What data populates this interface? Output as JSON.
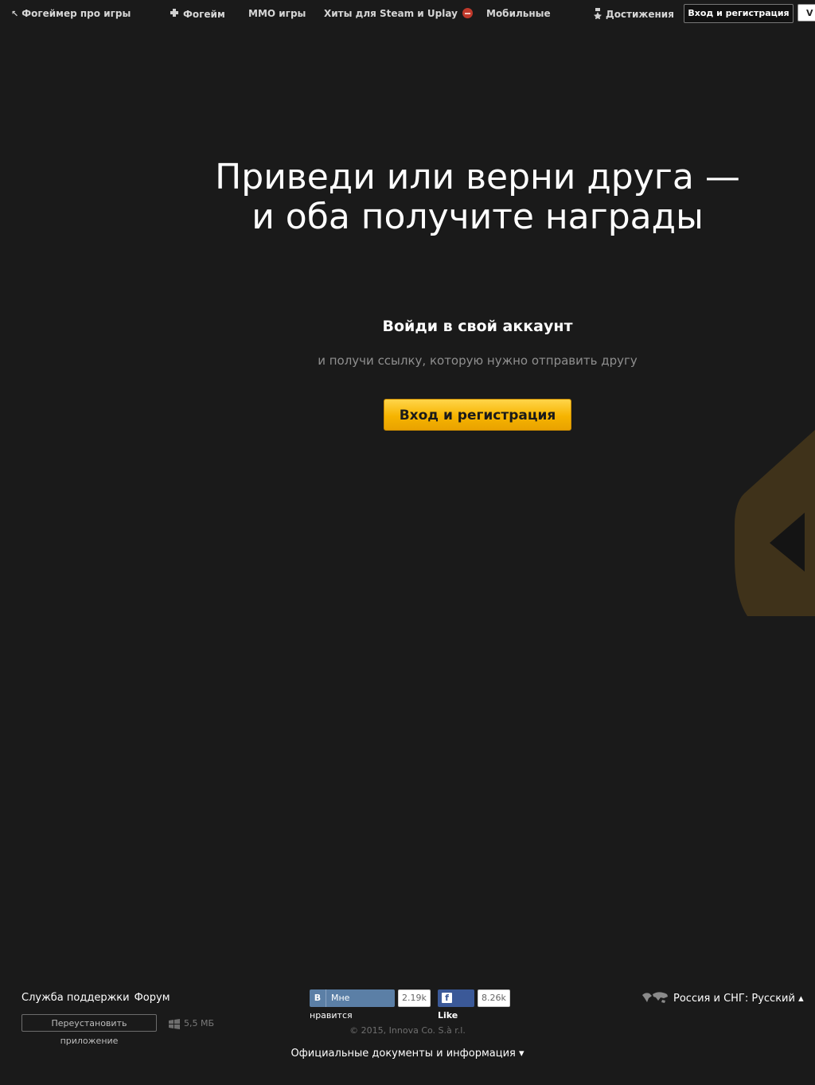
{
  "nav": {
    "back_link": "Фогеймер про игры",
    "fogame": "Фогейм",
    "mmo": "ММО игры",
    "steam_uplay": "Хиты для Steam и Uplay",
    "mobile": "Мобильные",
    "achievements": "Достижения",
    "login_button": "Вход и регистрация",
    "corner_button": "V"
  },
  "hero": {
    "title_line1": "Приведи или верни друга —",
    "title_line2": "и оба получите награды",
    "subheading": "Войди в свой аккаунт",
    "subtext": "и получи ссылку, которую нужно отправить другу",
    "cta": "Вход и регистрация"
  },
  "footer": {
    "support": "Служба поддержки",
    "forum": "Форум",
    "reinstall": "Переустановить приложение",
    "size": "5,5 МБ",
    "vk_letter": "В",
    "vk_like": "Мне нравится",
    "vk_count": "2.19k",
    "fb_like": "Like",
    "fb_count": "8.26k",
    "copyright": "© 2015, Innova Co. S.à r.l.",
    "docs": "Официальные документы и информация ▾",
    "region": "Россия и СНГ: Русский ▴"
  },
  "colors": {
    "background": "#1a1a1a",
    "accent": "#f6b400",
    "vk": "#5b7fa6",
    "facebook": "#3b5998",
    "deco": "#3f321a"
  }
}
